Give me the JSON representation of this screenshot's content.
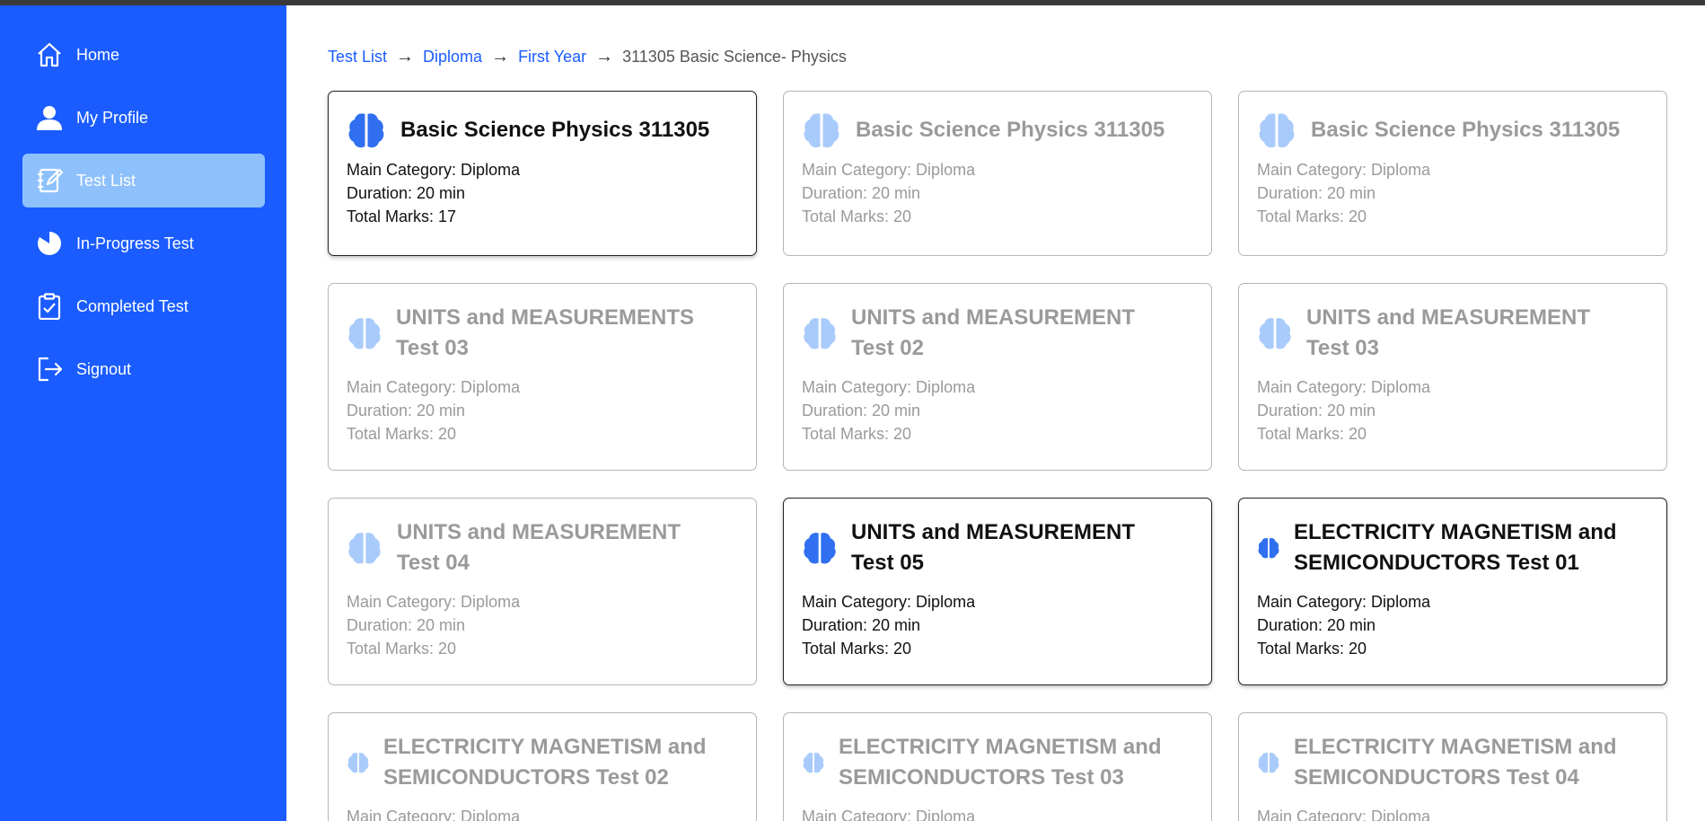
{
  "colors": {
    "sidebar": "#1a5cff",
    "active_item": "#8ec1fc",
    "link": "#1a5cff",
    "brain_enabled": "#2f6ff0",
    "brain_disabled": "#a9cbfb"
  },
  "sidebar": {
    "items": [
      {
        "label": "Home",
        "icon": "home-icon"
      },
      {
        "label": "My Profile",
        "icon": "user-icon"
      },
      {
        "label": "Test List",
        "icon": "notebook-edit-icon",
        "active": true
      },
      {
        "label": "In-Progress Test",
        "icon": "pie-chart-icon"
      },
      {
        "label": "Completed Test",
        "icon": "clipboard-check-icon"
      },
      {
        "label": "Signout",
        "icon": "logout-icon"
      }
    ]
  },
  "breadcrumb": {
    "items": [
      "Test List",
      "Diploma",
      "First Year"
    ],
    "separator": "→",
    "current": "311305 Basic Science- Physics"
  },
  "cards": [
    {
      "title": "Basic Science Physics 311305",
      "category": "Main Category: Diploma",
      "duration": "Duration: 20 min",
      "marks": "Total Marks: 17",
      "enabled": true
    },
    {
      "title": "Basic Science Physics 311305",
      "category": "Main Category: Diploma",
      "duration": "Duration: 20 min",
      "marks": "Total Marks: 20",
      "enabled": false
    },
    {
      "title": "Basic Science Physics 311305",
      "category": "Main Category: Diploma",
      "duration": "Duration: 20 min",
      "marks": "Total Marks: 20",
      "enabled": false
    },
    {
      "title": "UNITS and MEASUREMENTS Test 03",
      "category": "Main Category: Diploma",
      "duration": "Duration: 20 min",
      "marks": "Total Marks: 20",
      "enabled": false
    },
    {
      "title": "UNITS and MEASUREMENT Test 02",
      "category": "Main Category: Diploma",
      "duration": "Duration: 20 min",
      "marks": "Total Marks: 20",
      "enabled": false
    },
    {
      "title": "UNITS and MEASUREMENT Test 03",
      "category": "Main Category: Diploma",
      "duration": "Duration: 20 min",
      "marks": "Total Marks: 20",
      "enabled": false
    },
    {
      "title": "UNITS and MEASUREMENT Test 04",
      "category": "Main Category: Diploma",
      "duration": "Duration: 20 min",
      "marks": "Total Marks: 20",
      "enabled": false
    },
    {
      "title": "UNITS and MEASUREMENT Test 05",
      "category": "Main Category: Diploma",
      "duration": "Duration: 20 min",
      "marks": "Total Marks: 20",
      "enabled": true
    },
    {
      "title": "ELECTRICITY MAGNETISM and SEMICONDUCTORS Test 01",
      "category": "Main Category: Diploma",
      "duration": "Duration: 20 min",
      "marks": "Total Marks: 20",
      "enabled": true
    },
    {
      "title": "ELECTRICITY MAGNETISM and SEMICONDUCTORS Test 02",
      "category": "Main Category: Diploma",
      "duration": "",
      "marks": "",
      "enabled": false
    },
    {
      "title": "ELECTRICITY MAGNETISM and SEMICONDUCTORS Test 03",
      "category": "Main Category: Diploma",
      "duration": "",
      "marks": "",
      "enabled": false
    },
    {
      "title": "ELECTRICITY MAGNETISM and SEMICONDUCTORS Test 04",
      "category": "Main Category: Diploma",
      "duration": "",
      "marks": "",
      "enabled": false
    }
  ]
}
